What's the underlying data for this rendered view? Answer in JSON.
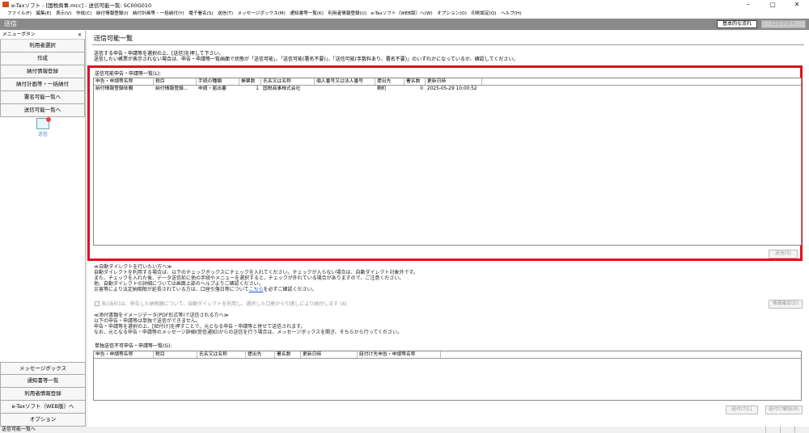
{
  "window": {
    "title": "e-Taxソフト - [国税商事.mcc] - 送信可能一覧: SC00G010",
    "btn_min": "–",
    "btn_max": "▢",
    "btn_close": "✕"
  },
  "menubar": [
    "ファイル(F)",
    "編集(E)",
    "表示(V)",
    "作成(C)",
    "納付情報登録(I)",
    "納付計画等・一括納付(Y)",
    "電子署名(S)",
    "送信(T)",
    "メッセージボックス(M)",
    "通知書等一覧(K)",
    "利用者情報登録(U)",
    "e-Taxソフト（WEB版）へ(W)",
    "オプション(O)",
    "印刷設定(Q)",
    "ヘルプ(H)"
  ],
  "header": {
    "title": "送信",
    "flow_button": "基本的な流れ",
    "logout_button": "ログアウト"
  },
  "sidebar": {
    "menu_header": "メニューボタン",
    "close": "✕",
    "items": [
      "利用者選択",
      "作成",
      "納付情報登録",
      "納付計画等・一括納付",
      "署名可能一覧へ",
      "送信可能一覧へ"
    ],
    "send_label": "送信",
    "bottom_items": [
      "メッセージボックス",
      "通知書等一覧",
      "利用者情報登録",
      "e-Taxソフト（WEB版）へ",
      "オプション"
    ]
  },
  "main": {
    "title": "送信可能一覧",
    "info_lines": [
      "送信する申告・申請等を選択の上、[送信]を押して下さい。",
      "送信したい帳票が表示されない場合は、申告・申請等一覧画面で状態が「送信可能」、「送信可能(署名不要)」、「送信可能(手数料あり、署名不要)」のいずれかになっているか、確認してください。"
    ],
    "list_label": "送信可能申告・申請等一覧(L):",
    "columns": [
      "申告・申請等名称",
      "税目",
      "手続の種類",
      "帳票数",
      "氏名又は名称",
      "個人番号又は法人番号",
      "提出先",
      "署名数",
      "更新日時"
    ],
    "rows": [
      [
        "納付情報登録依頼",
        "納付情報登録…",
        "申請・届出書",
        "1",
        "国税商事株式会社",
        "",
        "麹町",
        "0",
        "2025-05-29 10:00:52"
      ]
    ],
    "send_button": "送信(S)",
    "direct_lines": [
      "≪自動ダイレクトを行いたい方へ≫",
      "自動ダイレクトを利用する場合は、以下のチェックボックスにチェックを入れてください。チェックが入らない場合は、自動ダイレクト対象外です。",
      "また、チェックを入れた後、データ送信前に他の手続やメニューを選択すると、チェックが外れている場合がありますので、ご注意ください。",
      "他、自動ダイレクトの詳細については画面上部のヘルプよりご確認ください。"
    ],
    "disaster_prefix": "災害等により法定納期限が延長されている方は、口座引落日等について",
    "disaster_link": "こちら",
    "disaster_suffix": "を必ずご確認ください。",
    "checkbox_label": "私(当社)は、申告した納税額について、自動ダイレクトを利用し、選択した口座から引落しにより納付します (A)",
    "confirm_button": "情報確認(D)",
    "attach_lines": [
      "≪添付書類をイメージデータ(PDF形式等)で送信される方へ≫",
      "以下の申告・申請等は単独で送信ができません。",
      "申告・申請等を選択の上、[紐付け]を押すことで、元となる申告・申請等と併せて送信されます。",
      "なお、元となる申告・申請等のメッセージ詳細(受信通知)からの送信を行う場合は、メッセージボックスを開き、そちらから行ってください。"
    ],
    "single_label": "単独送信不可申告・申請等一覧(G):",
    "single_columns": [
      "申告・申請等名称",
      "税目",
      "氏名又は名称",
      "提出先",
      "署名数",
      "更新日時",
      "紐付け先申告・申請等名称"
    ],
    "link_button": "紐付け(L)",
    "unlink_button": "紐付け解除(R)"
  },
  "status": "送信可能一覧へ"
}
